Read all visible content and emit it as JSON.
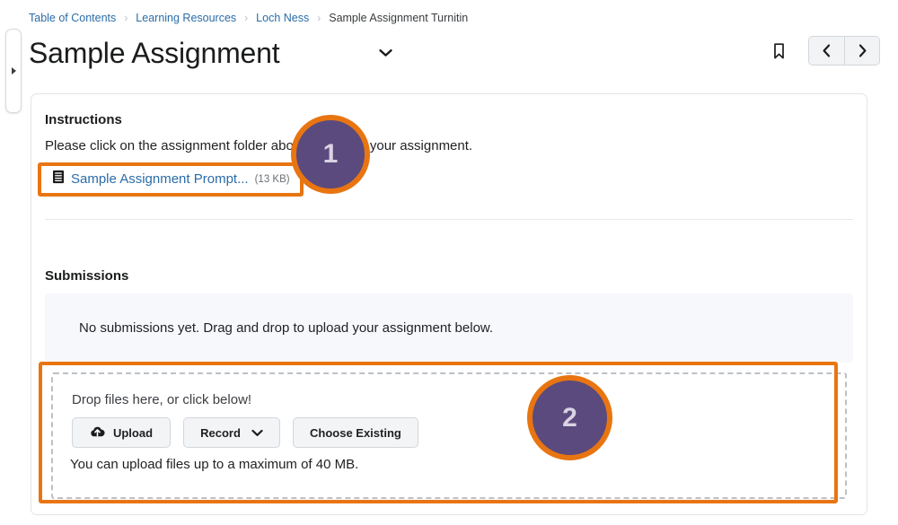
{
  "breadcrumb": {
    "items": [
      {
        "label": "Table of Contents",
        "current": false
      },
      {
        "label": "Learning Resources",
        "current": false
      },
      {
        "label": "Loch Ness",
        "current": false
      },
      {
        "label": "Sample Assignment Turnitin",
        "current": true
      }
    ],
    "separator": "›"
  },
  "header": {
    "title": "Sample Assignment",
    "title_caret_icon": "chevron-down-icon",
    "bookmark_icon": "bookmark-icon",
    "prev_label": "‹",
    "next_label": "›"
  },
  "panel_handle": {
    "expand_icon": "expand-panel-triangle-icon"
  },
  "instructions": {
    "heading": "Instructions",
    "body": "Please click on the assignment folder above to submit your assignment.",
    "file": {
      "icon": "file-document-icon",
      "name": "Sample Assignment Prompt...",
      "size": "(13 KB)"
    }
  },
  "submissions": {
    "heading": "Submissions",
    "empty_message": "No submissions yet. Drag and drop to upload your assignment below."
  },
  "dropzone": {
    "title": "Drop files here, or click below!",
    "note": "You can upload files up to a maximum of 40 MB.",
    "buttons": {
      "upload": "Upload",
      "upload_icon": "cloud-upload-icon",
      "record": "Record",
      "record_caret_icon": "chevron-down-icon",
      "choose_existing": "Choose Existing"
    }
  },
  "annotations": {
    "badge_1": "1",
    "badge_2": "2",
    "accent_color": "#e87511",
    "badge_fill_color": "#5b4a7d"
  }
}
